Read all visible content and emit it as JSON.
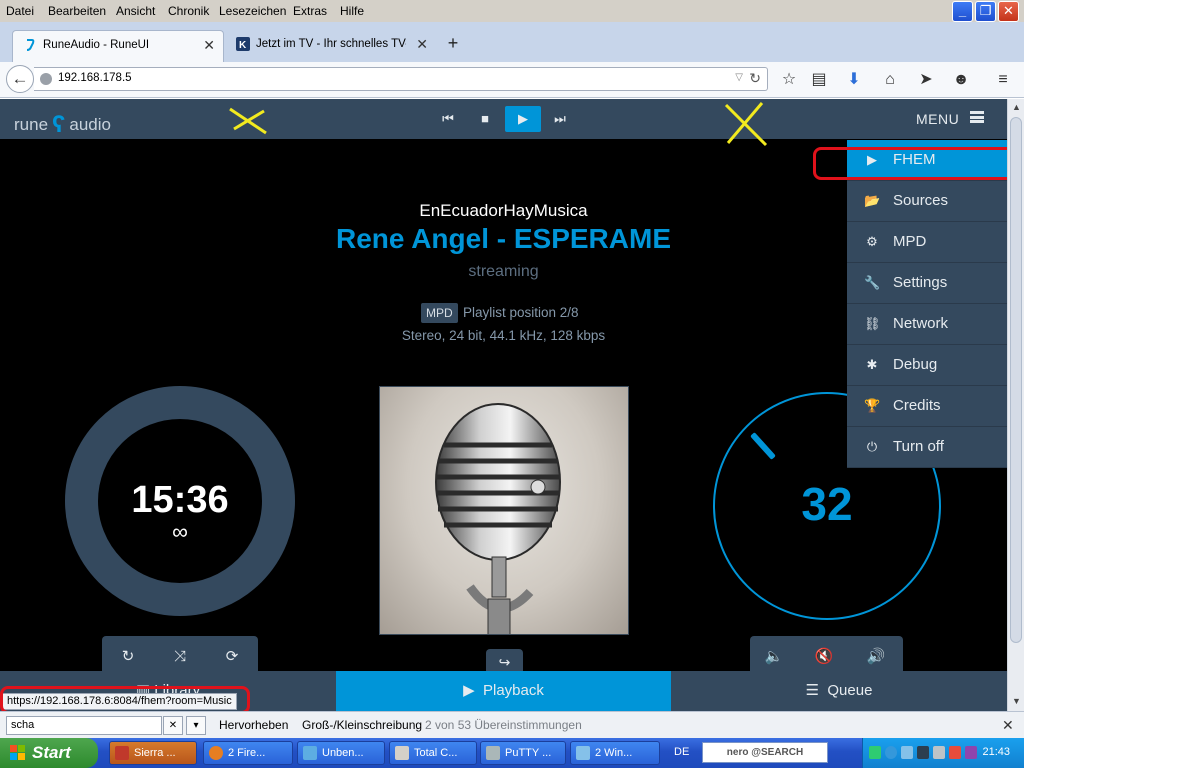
{
  "menubar": {
    "items": [
      {
        "label": "Datei",
        "key": "D"
      },
      {
        "label": "Bearbeiten",
        "key": "B"
      },
      {
        "label": "Ansicht",
        "key": "A"
      },
      {
        "label": "Chronik",
        "key": "C"
      },
      {
        "label": "Lesezeichen",
        "key": "L"
      },
      {
        "label": "Extras",
        "key": "E"
      },
      {
        "label": "Hilfe",
        "key": "H"
      }
    ]
  },
  "window_buttons": {
    "minimize": "_",
    "maximize": "❐",
    "close": "✕"
  },
  "tabs": [
    {
      "title": "RuneAudio - RuneUI",
      "close": "✕",
      "active": true
    },
    {
      "title": "Jetzt im TV - Ihr schnelles TV-...",
      "close": "✕",
      "active": false
    }
  ],
  "newtab_label": "+",
  "navbar": {
    "url": "192.168.178.5",
    "icons": [
      "bookmark-star-icon",
      "reading-list-icon",
      "download-icon",
      "home-icon",
      "send-icon",
      "chat-icon",
      "hamburger-menu-icon"
    ]
  },
  "rune": {
    "logo_left": "rune",
    "logo_mark": "ʕ",
    "logo_right": "audio",
    "menu_label": "MENU",
    "station": "EnEcuadorHayMusica",
    "song": "Rene Angel - ESPERAME",
    "status": "streaming",
    "source_badge": "MPD",
    "playlist_position": "Playlist position 2/8",
    "format": "Stereo, 24 bit, 44.1 kHz, 128 kbps",
    "elapsed": "15:36",
    "total": "∞",
    "volume": "32",
    "volume_level": 32,
    "menu_items": [
      {
        "label": "FHEM",
        "icon": "play-icon",
        "glyph": "▶",
        "active": true
      },
      {
        "label": "Sources",
        "icon": "folder-open-icon",
        "glyph": "📂",
        "active": false
      },
      {
        "label": "MPD",
        "icon": "gears-icon",
        "glyph": "⚙",
        "active": false
      },
      {
        "label": "Settings",
        "icon": "wrench-icon",
        "glyph": "🔧",
        "active": false
      },
      {
        "label": "Network",
        "icon": "sitemap-icon",
        "glyph": "⛓",
        "active": false
      },
      {
        "label": "Debug",
        "icon": "bug-icon",
        "glyph": "✱",
        "active": false
      },
      {
        "label": "Credits",
        "icon": "trophy-icon",
        "glyph": "🏆",
        "active": false
      },
      {
        "label": "Turn off",
        "icon": "power-icon",
        "glyph": "⏻",
        "active": false
      }
    ],
    "footer": {
      "library": "Library",
      "playback": "Playback",
      "queue": "Queue"
    }
  },
  "status_url": "https://192.168.178.6:8084/fhem?room=Music",
  "findbar": {
    "query": "scha",
    "highlight": "Hervorheben",
    "highlight_key": "H",
    "case": "Groß-/Kleinschreibung",
    "case_key": "G",
    "count": "2 von 53 Übereinstimmungen",
    "close": "✕"
  },
  "taskbar": {
    "start": "Start",
    "buttons": [
      {
        "label": "Sierra ...",
        "color": "#c0392b",
        "active": true
      },
      {
        "label": "2 Fire...",
        "color": "#e67e22",
        "active": false
      },
      {
        "label": "Unben...",
        "color": "#5dade2",
        "active": false
      },
      {
        "label": "Total C...",
        "color": "#d4d0c8",
        "active": false
      },
      {
        "label": "PuTTY ...",
        "color": "#aab7b8",
        "active": false
      },
      {
        "label": "2 Win...",
        "color": "#85c1e9",
        "active": false
      }
    ],
    "lang": "DE",
    "search_brand": "nero @SEARCH",
    "clock": "21:43"
  },
  "colors": {
    "accent": "#0095d8",
    "panel": "#34495e",
    "highlight_box": "#e0121b",
    "annotation_cross": "#f2ea1f"
  }
}
